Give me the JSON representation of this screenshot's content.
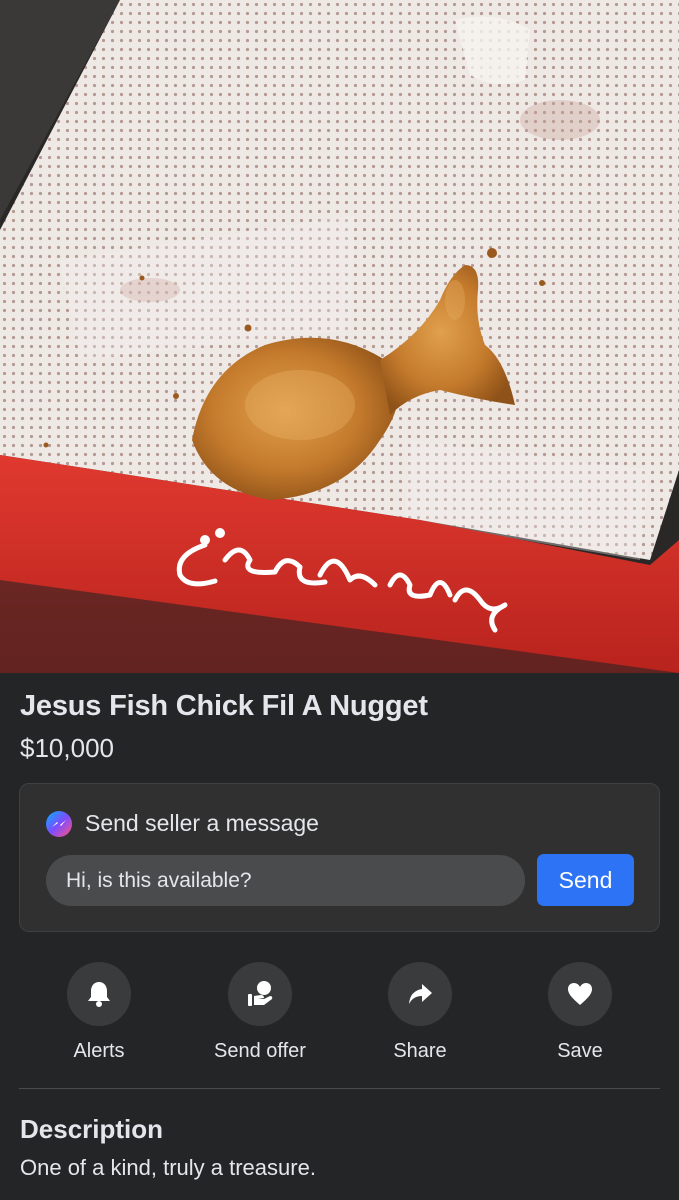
{
  "listing": {
    "title": "Jesus Fish Chick Fil A Nugget",
    "price": "$10,000",
    "photo_icon": "chicken-nugget-photo",
    "box_brand_text": "Chick-fil-A"
  },
  "message": {
    "header_label": "Send seller a message",
    "header_icon": "messenger-icon",
    "input_value": "Hi, is this available?",
    "send_label": "Send"
  },
  "actions": [
    {
      "label": "Alerts",
      "icon": "bell-icon"
    },
    {
      "label": "Send offer",
      "icon": "send-offer-icon"
    },
    {
      "label": "Share",
      "icon": "share-arrow-icon"
    },
    {
      "label": "Save",
      "icon": "heart-icon"
    }
  ],
  "description": {
    "heading": "Description",
    "text": "One of a kind, truly a treasure."
  },
  "colors": {
    "background": "#242526",
    "card": "#303031",
    "accent_blue": "#2d73f5",
    "text": "#e4e6eb",
    "box_red": "#d9322b"
  }
}
